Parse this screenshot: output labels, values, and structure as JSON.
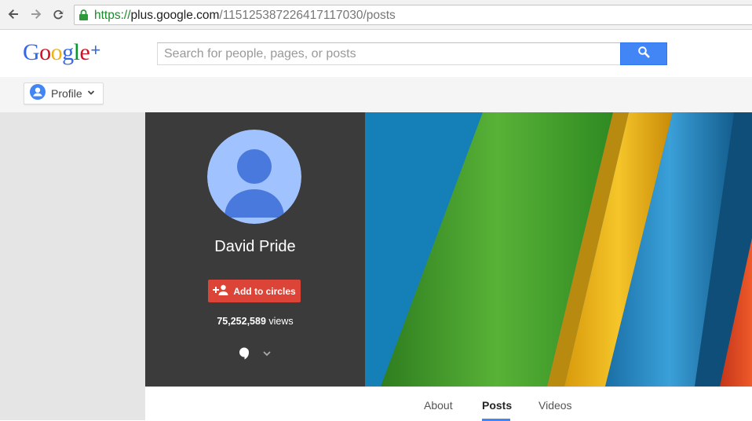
{
  "browser": {
    "url_proto": "https://",
    "url_host": "plus.google.com",
    "url_path": "/115125387226417117030/posts",
    "icons": [
      "back-arrow-icon",
      "forward-arrow-icon",
      "reload-icon",
      "lock-icon"
    ]
  },
  "header": {
    "logo_letters": [
      "G",
      "o",
      "o",
      "g",
      "l",
      "e",
      "+"
    ],
    "logo_colors": [
      "#3369e8",
      "#d50f25",
      "#eeb211",
      "#3369e8",
      "#009925",
      "#d50f25",
      "#3369e8"
    ],
    "search_placeholder": "Search for people, pages, or posts",
    "search_icon": "magnifier-icon"
  },
  "profile_bar": {
    "dropdown_label": "Profile"
  },
  "profile": {
    "name": "David Pride",
    "add_button_label": "Add to circles",
    "views_count": "75,252,589",
    "views_suffix": " views"
  },
  "tabs": [
    {
      "label": "About",
      "active": false
    },
    {
      "label": "Posts",
      "active": true
    },
    {
      "label": "Videos",
      "active": false
    }
  ],
  "colors": {
    "accent_blue": "#4285f4",
    "add_red": "#db4437",
    "card_bg": "#3b3b3b"
  }
}
